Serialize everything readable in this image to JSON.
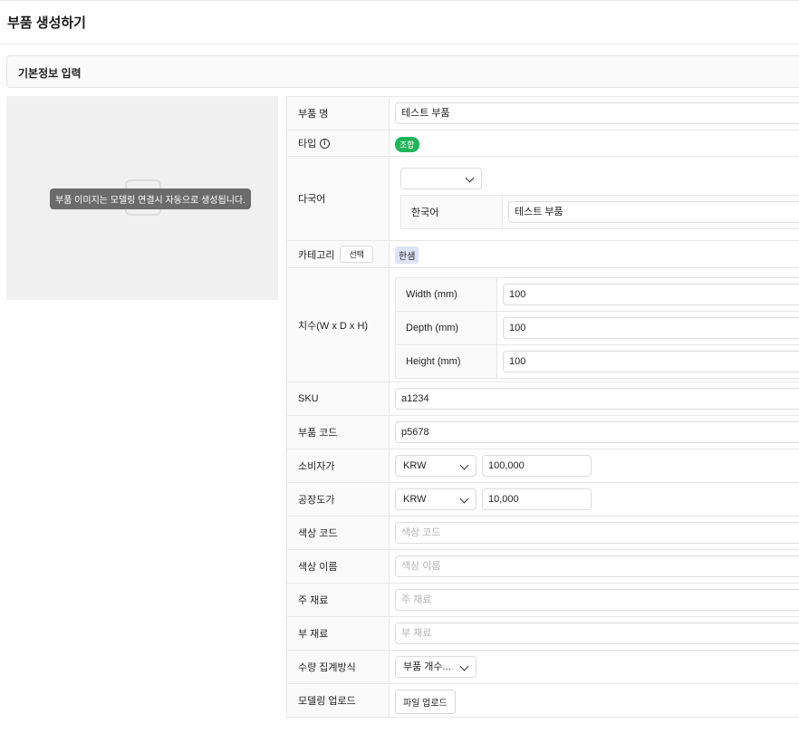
{
  "page": {
    "title": "부품 생성하기"
  },
  "section": {
    "title": "기본정보 입력"
  },
  "image": {
    "tooltip": "부품 이미지는 모델링 연결시 자동으로 생성됩니다."
  },
  "form": {
    "name": {
      "label": "부품 명",
      "value": "테스트 부품"
    },
    "type": {
      "label": "타입",
      "tag": "조합"
    },
    "multilang": {
      "label": "다국어",
      "select_value": "",
      "sub_label": "한국어",
      "sub_value": "테스트 부품"
    },
    "category": {
      "label": "카테고리",
      "button": "선택",
      "tag": "한샘"
    },
    "dimensions": {
      "label": "치수(W x D x H)",
      "rows": [
        {
          "label": "Width (mm)",
          "value": "100"
        },
        {
          "label": "Depth (mm)",
          "value": "100"
        },
        {
          "label": "Height (mm)",
          "value": "100"
        }
      ]
    },
    "sku": {
      "label": "SKU",
      "value": "a1234"
    },
    "code": {
      "label": "부품 코드",
      "value": "p5678"
    },
    "consumer_price": {
      "label": "소비자가",
      "currency": "KRW",
      "value": "100,000"
    },
    "factory_price": {
      "label": "공장도가",
      "currency": "KRW",
      "value": "10,000"
    },
    "color_code": {
      "label": "색상 코드",
      "placeholder": "색상 코드"
    },
    "color_name": {
      "label": "색상 이름",
      "placeholder": "색상 이름"
    },
    "main_material": {
      "label": "주 재료",
      "placeholder": "주 재료"
    },
    "sub_material": {
      "label": "부 재료",
      "placeholder": "부 재료"
    },
    "quantity_method": {
      "label": "수량 집계방식",
      "value": "부품 개수..."
    },
    "modeling_upload": {
      "label": "모델링 업로드",
      "button": "파일 업로드"
    }
  },
  "colors": {
    "tag_green": "#1cb55a",
    "tag_blue": "#dfe3f7",
    "tooltip_bg": "#6b6b6b"
  }
}
